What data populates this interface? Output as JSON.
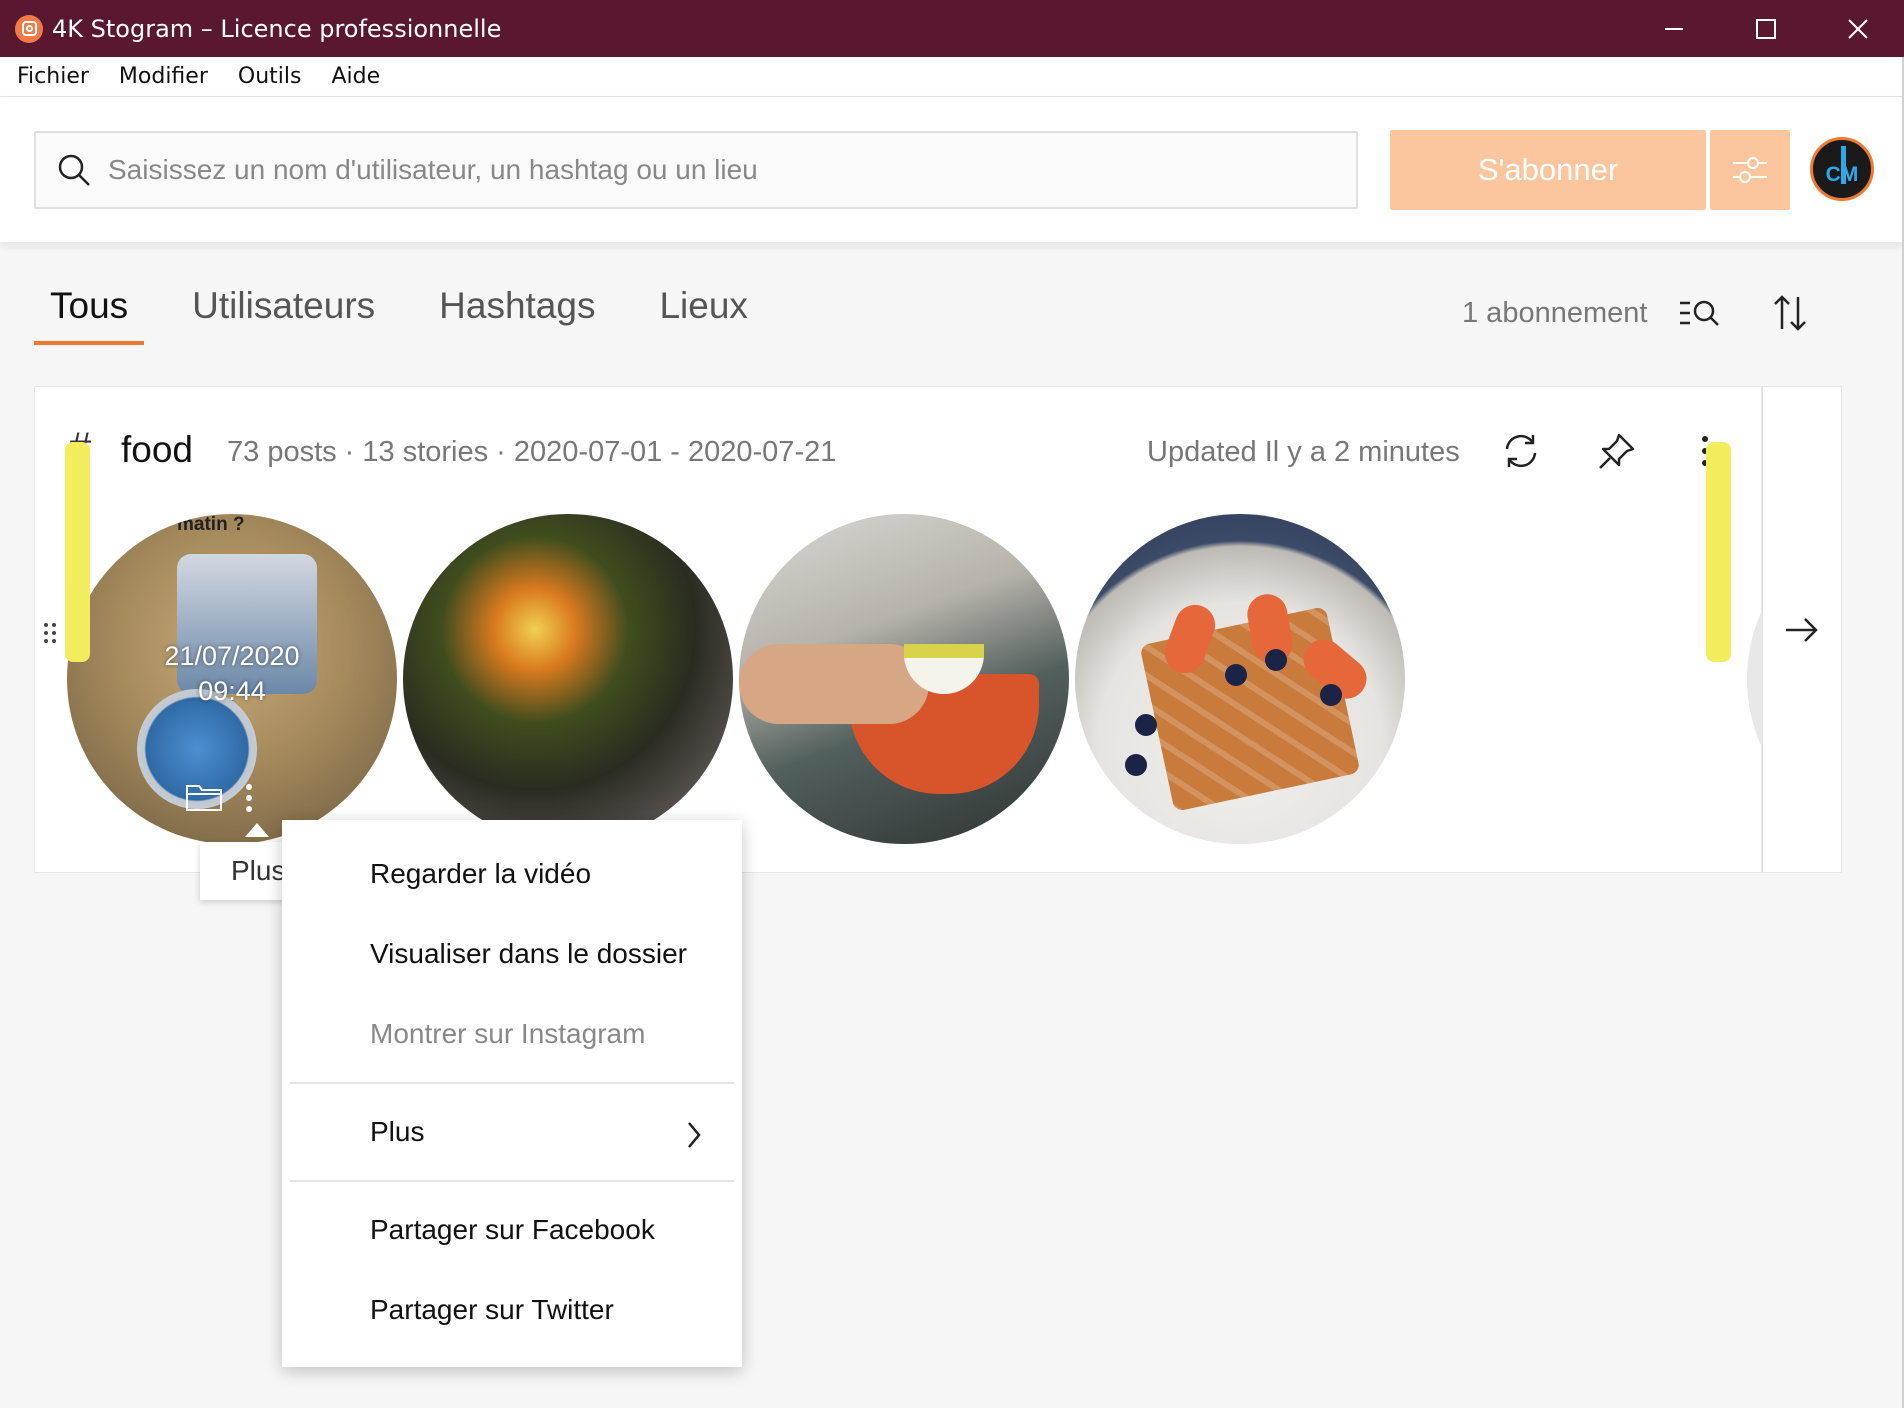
{
  "window": {
    "title": "4K Stogram – Licence professionnelle"
  },
  "menubar": {
    "items": [
      "Fichier",
      "Modifier",
      "Outils",
      "Aide"
    ]
  },
  "search": {
    "placeholder": "Saisissez un nom d'utilisateur, un hashtag ou un lieu",
    "value": ""
  },
  "toolbar": {
    "subscribe_label": "S'abonner",
    "avatar_text": "CM",
    "accent_color": "#fbc59e"
  },
  "tabs": {
    "items": [
      "Tous",
      "Utilisateurs",
      "Hashtags",
      "Lieux"
    ],
    "active": "Tous",
    "subscriptions_count": "1 abonnement"
  },
  "subscription": {
    "hash_symbol": "#",
    "name": "food",
    "meta": "73 posts · 13 stories · 2020-07-01 - 2020-07-21",
    "updated": "Updated Il y a 2 minutes",
    "first_thumb": {
      "caption": "matin ?",
      "date": "21/07/2020",
      "time": "09:44"
    }
  },
  "tooltip": {
    "text": "Plus"
  },
  "context_menu": {
    "items": [
      {
        "label": "Regarder la vidéo",
        "disabled": false
      },
      {
        "label": "Visualiser dans le dossier",
        "disabled": false
      },
      {
        "label": "Montrer sur Instagram",
        "disabled": true
      },
      {
        "label": "Plus",
        "disabled": false,
        "submenu": true
      },
      {
        "label": "Partager sur Facebook",
        "disabled": false
      },
      {
        "label": "Partager sur Twitter",
        "disabled": false
      }
    ]
  },
  "colors": {
    "titlebar": "#5a1830",
    "tab_underline": "#f0772e"
  }
}
